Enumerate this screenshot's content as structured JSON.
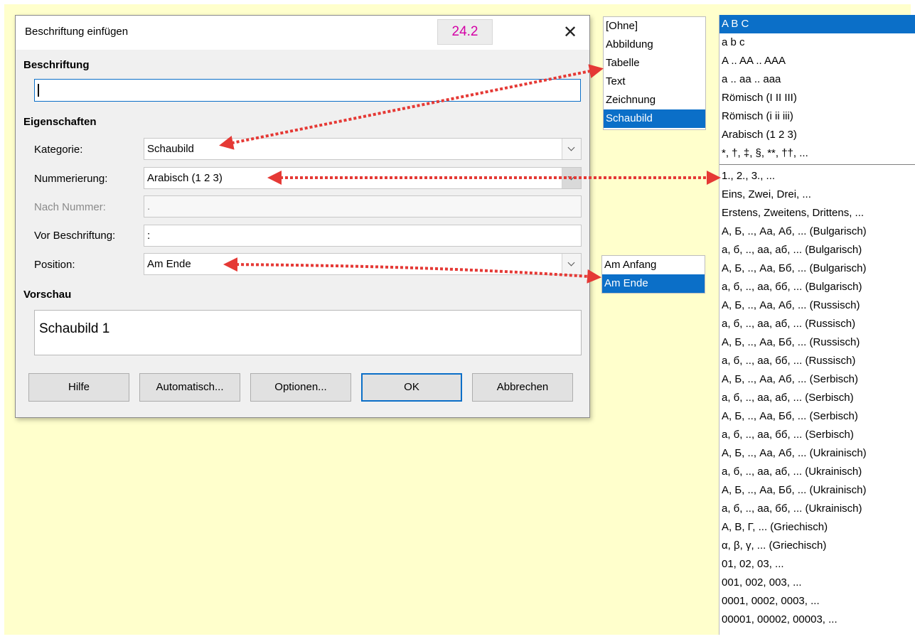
{
  "dialog": {
    "title": "Beschriftung einfügen",
    "version": "24.2",
    "close_symbol": "✕",
    "sections": {
      "caption_heading": "Beschriftung",
      "properties_heading": "Eigenschaften",
      "preview_heading": "Vorschau"
    },
    "fields": {
      "category_label": "Kategorie:",
      "category_value": "Schaubild",
      "numbering_label": "Nummerierung:",
      "numbering_value": "Arabisch (1 2 3)",
      "after_number_label": "Nach Nummer:",
      "after_number_value": ".",
      "before_caption_label": "Vor Beschriftung:",
      "before_caption_value": ":",
      "position_label": "Position:",
      "position_value": "Am Ende"
    },
    "preview_text": "Schaubild 1",
    "buttons": {
      "help": "Hilfe",
      "auto": "Automatisch...",
      "options": "Optionen...",
      "ok": "OK",
      "cancel": "Abbrechen"
    }
  },
  "category_list": [
    "[Ohne]",
    "Abbildung",
    "Tabelle",
    "Text",
    "Zeichnung",
    "Schaubild"
  ],
  "numbering_list_top": [
    "A B C",
    "a b c",
    "A .. AA .. AAA",
    "a .. aa .. aaa",
    "Römisch (I II III)",
    "Römisch (i ii iii)",
    "Arabisch (1 2 3)",
    "*, †, ‡, §, **, ††, ..."
  ],
  "numbering_list_bottom": [
    "1., 2., 3., ...",
    "Eins, Zwei, Drei, ...",
    "Erstens, Zweitens, Drittens, ...",
    "А, Б, .., Аа, Аб, ... (Bulgarisch)",
    "а, б, .., аа, аб, ... (Bulgarisch)",
    "А, Б, .., Аа, Бб, ... (Bulgarisch)",
    "а, б, .., аа, бб, ... (Bulgarisch)",
    "А, Б, .., Аа, Аб, ... (Russisch)",
    "а, б, .., аа, аб, ... (Russisch)",
    "А, Б, .., Аа, Бб, ... (Russisch)",
    "а, б, .., аа, бб, ... (Russisch)",
    "А, Б, .., Аа, Аб, ... (Serbisch)",
    "а, б, .., аа, аб, ... (Serbisch)",
    "А, Б, .., Аа, Бб, ... (Serbisch)",
    "а, б, .., аа, бб, ... (Serbisch)",
    "А, Б, .., Аа, Аб, ... (Ukrainisch)",
    "а, б, .., аа, аб, ... (Ukrainisch)",
    "А, Б, .., Аа, Бб, ... (Ukrainisch)",
    "а, б, .., аа, бб, ... (Ukrainisch)",
    "Α, Β, Γ, ... (Griechisch)",
    "α, β, γ, ... (Griechisch)",
    "01, 02, 03, ...",
    "001, 002, 003, ...",
    "0001, 0002, 0003, ...",
    "00001, 00002, 00003, ..."
  ],
  "position_list": [
    "Am Anfang",
    "Am Ende"
  ],
  "colors": {
    "background": "#ffffcc",
    "selection": "#0b6fc8",
    "arrow": "#e53935",
    "version": "#d400a6"
  }
}
